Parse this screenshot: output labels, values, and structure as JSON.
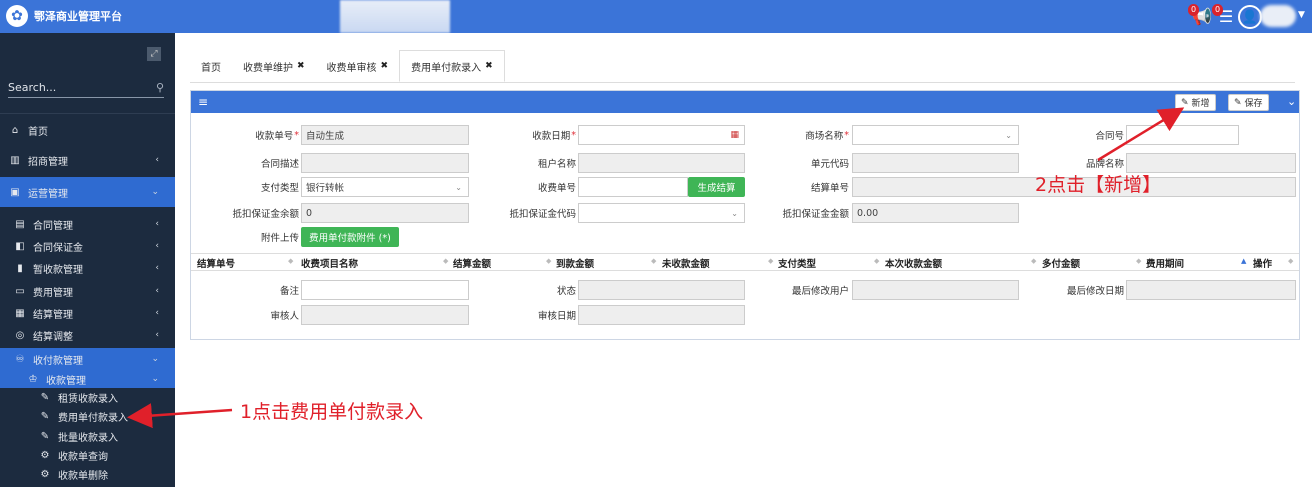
{
  "app": {
    "title": "鄂泽商业管理平台"
  },
  "header": {
    "notifications": [
      {
        "icon": "megaphone-icon",
        "count": "0"
      },
      {
        "icon": "message-icon",
        "count": "0"
      }
    ]
  },
  "sidebar": {
    "search_placeholder": "Search...",
    "items": [
      {
        "label": "首页",
        "icon": "home-icon"
      },
      {
        "label": "招商管理",
        "icon": "building-icon"
      },
      {
        "label": "运营管理",
        "icon": "operations-icon"
      },
      {
        "label": "合同管理",
        "icon": "contract-icon"
      },
      {
        "label": "合同保证金",
        "icon": "deposit-icon"
      },
      {
        "label": "暂收款管理",
        "icon": "bar-chart-icon"
      },
      {
        "label": "费用管理",
        "icon": "fee-icon"
      },
      {
        "label": "结算管理",
        "icon": "settlement-icon"
      },
      {
        "label": "结算调整",
        "icon": "search-settings-icon"
      },
      {
        "label": "收付款管理",
        "icon": "payment-icon"
      },
      {
        "label": "收款管理",
        "icon": "receipt-icon"
      },
      {
        "label": "租赁收款录入",
        "icon": "edit-icon"
      },
      {
        "label": "费用单付款录入",
        "icon": "edit-icon"
      },
      {
        "label": "批量收款录入",
        "icon": "edit-icon"
      },
      {
        "label": "收款单查询",
        "icon": "query-icon"
      },
      {
        "label": "收款单删除",
        "icon": "delete-doc-icon"
      }
    ]
  },
  "tabs": [
    {
      "label": "首页",
      "closable": false
    },
    {
      "label": "收费单维护",
      "closable": true
    },
    {
      "label": "收费单审核",
      "closable": true
    },
    {
      "label": "费用单付款录入",
      "closable": true
    }
  ],
  "tab_close_glyph": "✖",
  "toolbar": {
    "add_label": "新增",
    "save_label": "保存"
  },
  "form": {
    "receipt_no": {
      "label": "收款单号",
      "value": "自动生成"
    },
    "receipt_date": {
      "label": "收款日期",
      "value": ""
    },
    "mall_name": {
      "label": "商场名称",
      "value": ""
    },
    "contract_no": {
      "label": "合同号",
      "value": ""
    },
    "contract_desc": {
      "label": "合同描述",
      "value": ""
    },
    "tenant_name": {
      "label": "租户名称",
      "value": ""
    },
    "unit_code": {
      "label": "单元代码",
      "value": ""
    },
    "brand_name": {
      "label": "品牌名称",
      "value": ""
    },
    "payment_type": {
      "label": "支付类型",
      "value": "银行转帐"
    },
    "charge_no": {
      "label": "收费单号",
      "value": ""
    },
    "generate_btn": "生成结算",
    "settlement_no": {
      "label": "结算单号",
      "value": ""
    },
    "deposit_balance": {
      "label": "抵扣保证金余额",
      "value": "0"
    },
    "deposit_code": {
      "label": "抵扣保证金代码",
      "value": ""
    },
    "deposit_amount": {
      "label": "抵扣保证金金额",
      "value": "0.00"
    },
    "attachment": {
      "label": "附件上传",
      "button": "费用单付款附件 (*)"
    },
    "remark": {
      "label": "备注",
      "value": ""
    },
    "status": {
      "label": "状态",
      "value": ""
    },
    "last_modifier": {
      "label": "最后修改用户",
      "value": ""
    },
    "last_modified_date": {
      "label": "最后修改日期",
      "value": ""
    },
    "auditor": {
      "label": "审核人",
      "value": ""
    },
    "audit_date": {
      "label": "审核日期",
      "value": ""
    }
  },
  "grid": {
    "columns": [
      "结算单号",
      "收费项目名称",
      "结算金额",
      "到款金额",
      "未收款金额",
      "支付类型",
      "本次收款金额",
      "多付金额",
      "费用期间",
      "操作"
    ]
  },
  "annotations": {
    "step1": "1点击费用单付款录入",
    "step2": "2点击【新增】"
  },
  "colors": {
    "accent": "#3b74d8",
    "sidebar_bg": "#1c2b3f",
    "green": "#3fb556",
    "annotation": "#e0202a"
  }
}
